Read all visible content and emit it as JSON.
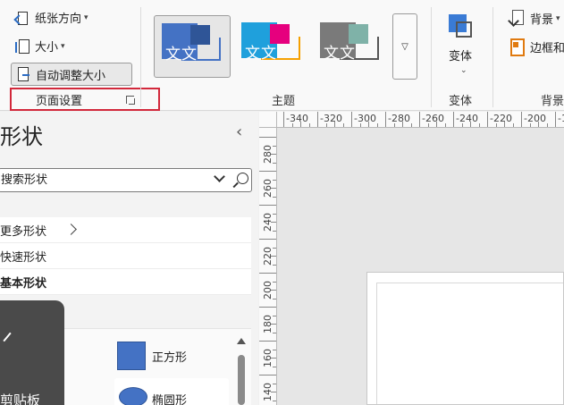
{
  "ribbon": {
    "page_setup_group": {
      "orientation_label": "纸张方向",
      "size_label": "大小",
      "auto_size_label": "自动调整大小",
      "group_label": "页面设置"
    },
    "themes_group": {
      "group_label": "主题",
      "themes": [
        {
          "text": "文文",
          "base_color": "#4472c4",
          "accent": "#2f5597",
          "selected": true
        },
        {
          "text": "文文",
          "base_color": "#1fa0dc",
          "accent": "#e6007e",
          "selected": false
        },
        {
          "text": "文文",
          "base_color": "#7a7a7a",
          "accent": "#7fb2a8",
          "selected": false
        }
      ]
    },
    "variants_group": {
      "button_label": "变体",
      "group_label": "变体"
    },
    "background_group": {
      "background_label": "背景",
      "border_label": "边框和",
      "group_label": "背景"
    }
  },
  "shapes_pane": {
    "title": "形状",
    "search_placeholder": "搜索形状",
    "items": [
      {
        "label": "更多形状",
        "has_submenu": true
      },
      {
        "label": "快速形状"
      },
      {
        "label": "基本形状",
        "selected": true
      }
    ],
    "stencil_tile_label": "剪贴板",
    "shapes": [
      {
        "label": "正方形",
        "icon": "square-shape-icon"
      },
      {
        "label": "椭圆形",
        "icon": "ellipse-shape-icon"
      }
    ]
  },
  "ruler": {
    "horizontal": [
      "-340",
      "-320",
      "-300",
      "-280",
      "-260",
      "-240",
      "-220",
      "-200",
      "-18"
    ],
    "vertical": [
      "280",
      "260",
      "240",
      "220",
      "200",
      "180",
      "160",
      "140"
    ]
  },
  "colors": {
    "highlight_border": "#d2283b",
    "theme_blue": "#4472c4"
  }
}
